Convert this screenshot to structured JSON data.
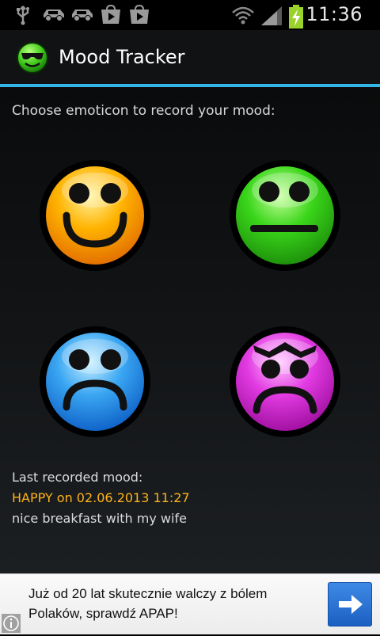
{
  "status_bar": {
    "time": "11:36",
    "icons": [
      "usb-icon",
      "car-icon",
      "car-icon",
      "play-store-icon",
      "play-store-icon",
      "wifi-icon",
      "signal-icon",
      "battery-charging-icon"
    ]
  },
  "app": {
    "title": "Mood Tracker",
    "icon": "smiley-sunglasses-icon"
  },
  "main": {
    "prompt": "Choose emoticon to record your mood:",
    "moods": [
      {
        "name": "happy",
        "color": "#ffa800"
      },
      {
        "name": "neutral",
        "color": "#35d61a"
      },
      {
        "name": "sad",
        "color": "#2d9bf0"
      },
      {
        "name": "angry",
        "color": "#e02de0"
      }
    ],
    "last_recorded": {
      "label": "Last recorded mood:",
      "value": "HAPPY on 02.06.2013 11:27",
      "note": "nice breakfast with my wife"
    }
  },
  "ad": {
    "text": "Już od 20 lat skutecznie walczy z bólem Polaków, sprawdź APAP!",
    "cta_icon": "arrow-right-icon",
    "info_icon": "info-icon"
  },
  "colors": {
    "accent": "#33b5e5",
    "highlight": "#ffb31a"
  }
}
